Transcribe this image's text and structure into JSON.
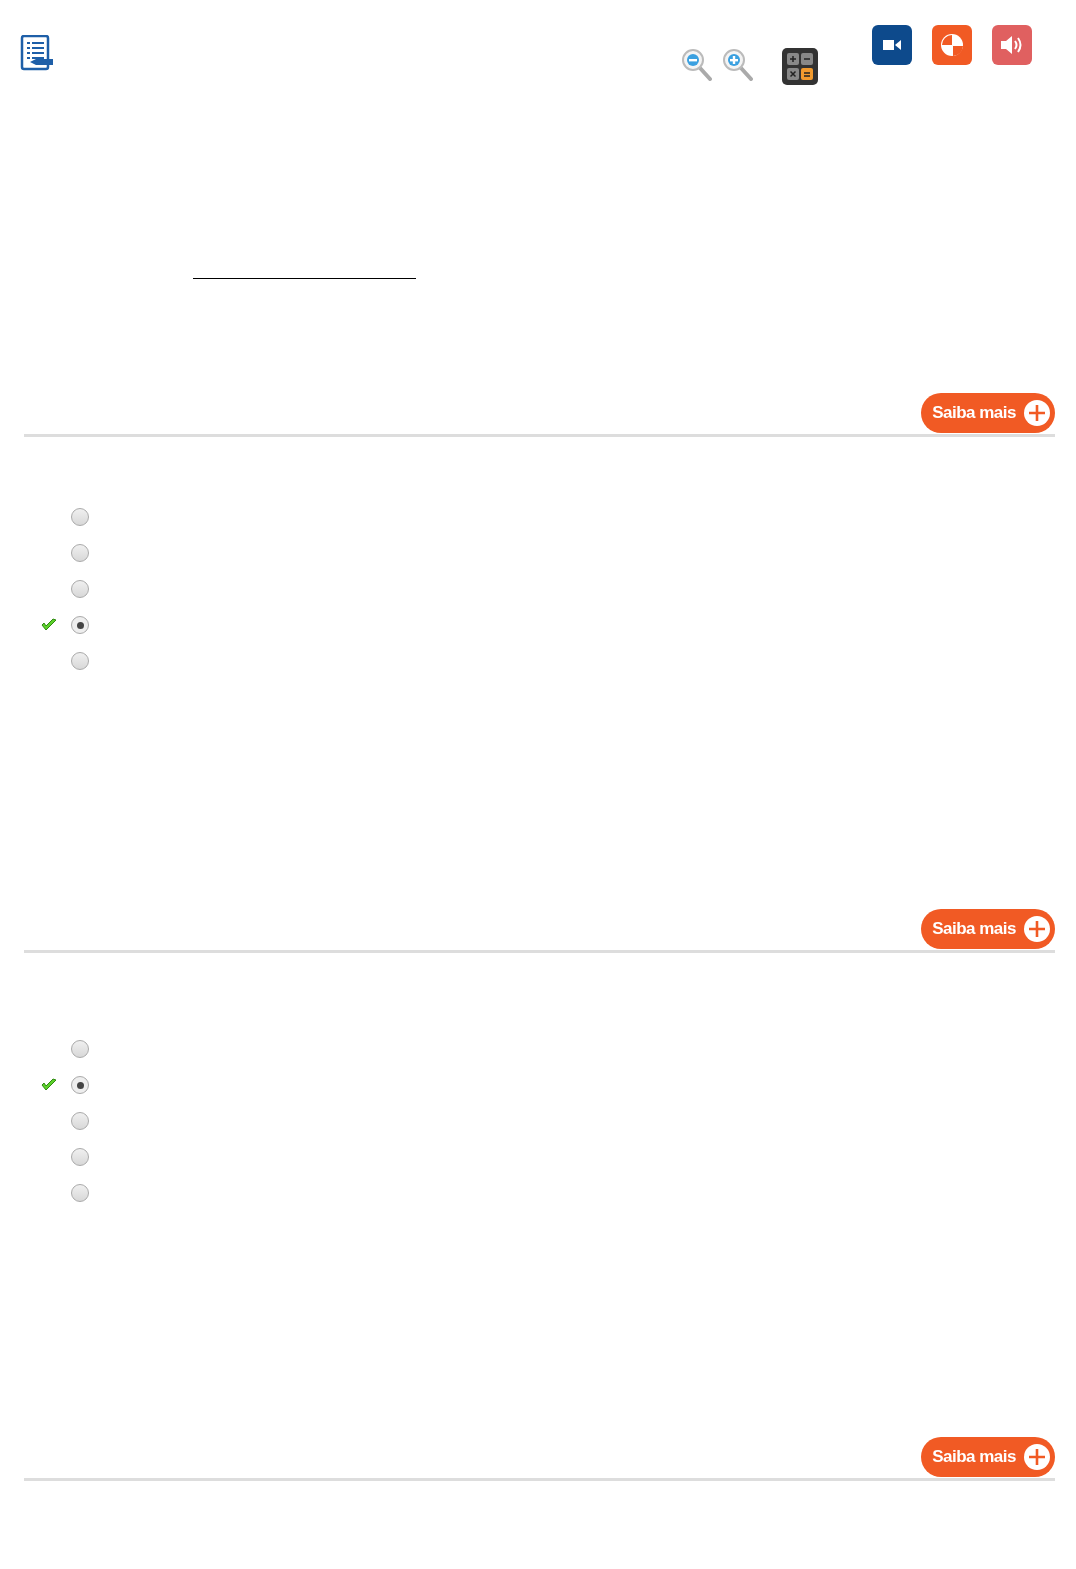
{
  "toolbar": {
    "tools": [
      {
        "kind": "zoom-out"
      },
      {
        "kind": "zoom-in"
      },
      {
        "kind": "calculator"
      }
    ],
    "media": [
      {
        "kind": "video",
        "color": "#0d4a8c"
      },
      {
        "kind": "chart",
        "color": "#f15a24"
      },
      {
        "kind": "audio",
        "color": "#e06060"
      }
    ]
  },
  "sections": [
    {
      "kind": "blank",
      "more_button": "Saiba mais"
    },
    {
      "kind": "choice",
      "more_button": "Saiba mais",
      "options": [
        {
          "selected": false,
          "correct": false
        },
        {
          "selected": false,
          "correct": false
        },
        {
          "selected": false,
          "correct": false
        },
        {
          "selected": true,
          "correct": true
        },
        {
          "selected": false,
          "correct": false
        }
      ]
    },
    {
      "kind": "choice",
      "more_button": "Saiba mais",
      "options": [
        {
          "selected": false,
          "correct": false
        },
        {
          "selected": true,
          "correct": true
        },
        {
          "selected": false,
          "correct": false
        },
        {
          "selected": false,
          "correct": false
        },
        {
          "selected": false,
          "correct": false
        }
      ]
    }
  ]
}
